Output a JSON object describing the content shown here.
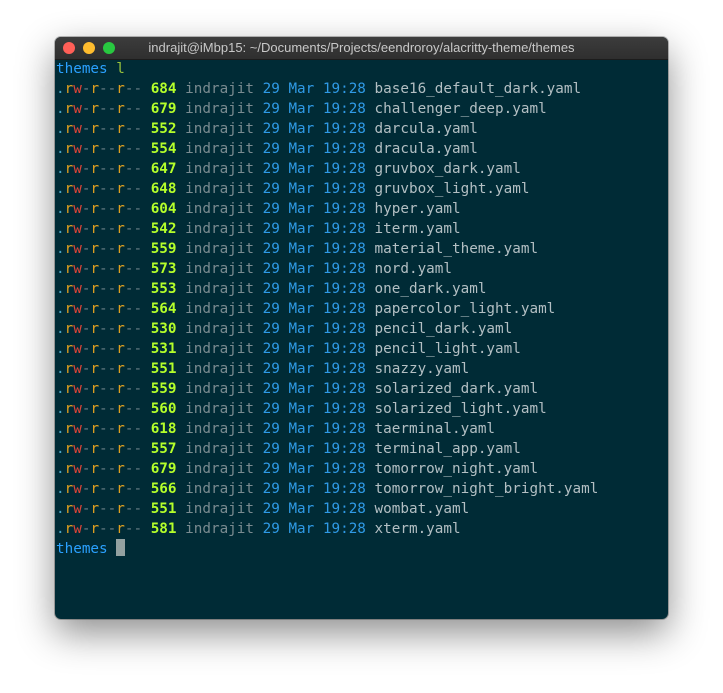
{
  "window": {
    "title": "indrajit@iMbp15: ~/Documents/Projects/eendroroy/alacritty-theme/themes"
  },
  "prompt": {
    "dir": "themes",
    "command": "l"
  },
  "listing": [
    {
      "perms": ".rw-r--r--",
      "size": "684",
      "user": "indrajit",
      "date": "29 Mar 19:28",
      "name": "base16_default_dark.yaml"
    },
    {
      "perms": ".rw-r--r--",
      "size": "679",
      "user": "indrajit",
      "date": "29 Mar 19:28",
      "name": "challenger_deep.yaml"
    },
    {
      "perms": ".rw-r--r--",
      "size": "552",
      "user": "indrajit",
      "date": "29 Mar 19:28",
      "name": "darcula.yaml"
    },
    {
      "perms": ".rw-r--r--",
      "size": "554",
      "user": "indrajit",
      "date": "29 Mar 19:28",
      "name": "dracula.yaml"
    },
    {
      "perms": ".rw-r--r--",
      "size": "647",
      "user": "indrajit",
      "date": "29 Mar 19:28",
      "name": "gruvbox_dark.yaml"
    },
    {
      "perms": ".rw-r--r--",
      "size": "648",
      "user": "indrajit",
      "date": "29 Mar 19:28",
      "name": "gruvbox_light.yaml"
    },
    {
      "perms": ".rw-r--r--",
      "size": "604",
      "user": "indrajit",
      "date": "29 Mar 19:28",
      "name": "hyper.yaml"
    },
    {
      "perms": ".rw-r--r--",
      "size": "542",
      "user": "indrajit",
      "date": "29 Mar 19:28",
      "name": "iterm.yaml"
    },
    {
      "perms": ".rw-r--r--",
      "size": "559",
      "user": "indrajit",
      "date": "29 Mar 19:28",
      "name": "material_theme.yaml"
    },
    {
      "perms": ".rw-r--r--",
      "size": "573",
      "user": "indrajit",
      "date": "29 Mar 19:28",
      "name": "nord.yaml"
    },
    {
      "perms": ".rw-r--r--",
      "size": "553",
      "user": "indrajit",
      "date": "29 Mar 19:28",
      "name": "one_dark.yaml"
    },
    {
      "perms": ".rw-r--r--",
      "size": "564",
      "user": "indrajit",
      "date": "29 Mar 19:28",
      "name": "papercolor_light.yaml"
    },
    {
      "perms": ".rw-r--r--",
      "size": "530",
      "user": "indrajit",
      "date": "29 Mar 19:28",
      "name": "pencil_dark.yaml"
    },
    {
      "perms": ".rw-r--r--",
      "size": "531",
      "user": "indrajit",
      "date": "29 Mar 19:28",
      "name": "pencil_light.yaml"
    },
    {
      "perms": ".rw-r--r--",
      "size": "551",
      "user": "indrajit",
      "date": "29 Mar 19:28",
      "name": "snazzy.yaml"
    },
    {
      "perms": ".rw-r--r--",
      "size": "559",
      "user": "indrajit",
      "date": "29 Mar 19:28",
      "name": "solarized_dark.yaml"
    },
    {
      "perms": ".rw-r--r--",
      "size": "560",
      "user": "indrajit",
      "date": "29 Mar 19:28",
      "name": "solarized_light.yaml"
    },
    {
      "perms": ".rw-r--r--",
      "size": "618",
      "user": "indrajit",
      "date": "29 Mar 19:28",
      "name": "taerminal.yaml"
    },
    {
      "perms": ".rw-r--r--",
      "size": "557",
      "user": "indrajit",
      "date": "29 Mar 19:28",
      "name": "terminal_app.yaml"
    },
    {
      "perms": ".rw-r--r--",
      "size": "679",
      "user": "indrajit",
      "date": "29 Mar 19:28",
      "name": "tomorrow_night.yaml"
    },
    {
      "perms": ".rw-r--r--",
      "size": "566",
      "user": "indrajit",
      "date": "29 Mar 19:28",
      "name": "tomorrow_night_bright.yaml"
    },
    {
      "perms": ".rw-r--r--",
      "size": "551",
      "user": "indrajit",
      "date": "29 Mar 19:28",
      "name": "wombat.yaml"
    },
    {
      "perms": ".rw-r--r--",
      "size": "581",
      "user": "indrajit",
      "date": "29 Mar 19:28",
      "name": "xterm.yaml"
    }
  ],
  "prompt_after": {
    "dir": "themes"
  },
  "colors": {
    "background": "#002b36",
    "directory": "#2aa1ff",
    "size": "#b5ff2a",
    "date": "#2f9ae6",
    "perm_read": "#e0a020",
    "perm_write": "#e04438"
  }
}
